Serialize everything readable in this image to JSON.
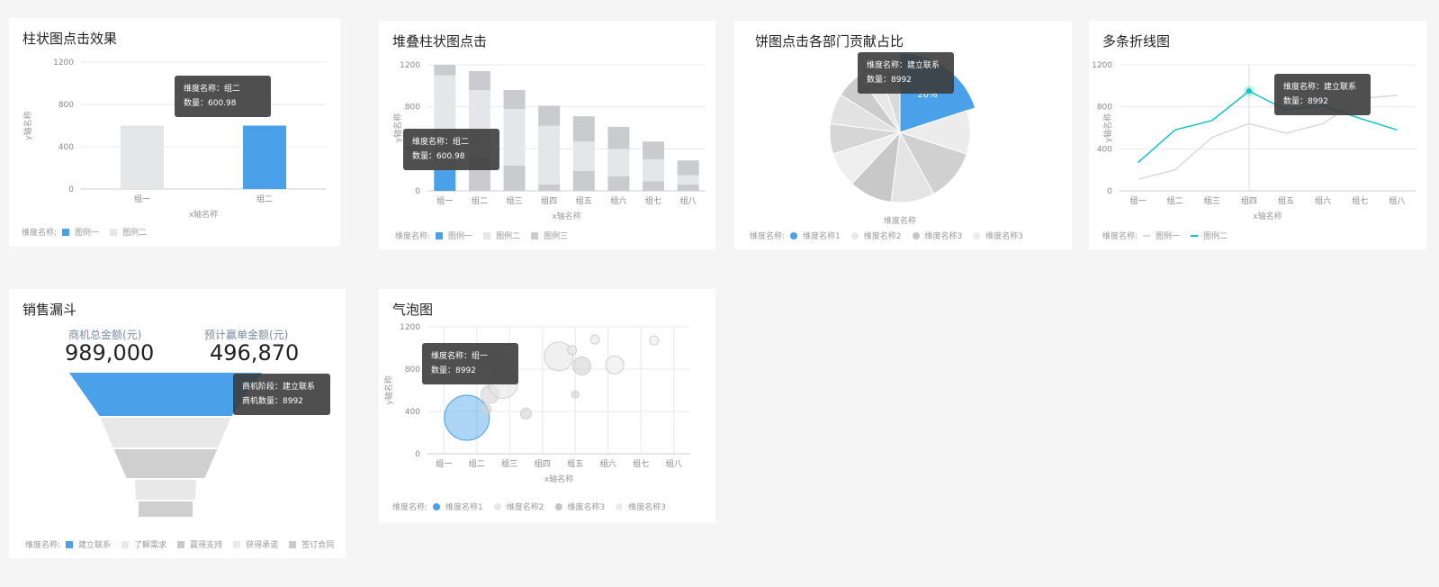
{
  "colors": {
    "blue": "#4aa1ea",
    "cyan": "#13c2c2",
    "light": "#e4e6ea",
    "mid": "#c9cbcf",
    "lightgray": "#e8e8e8",
    "darkgray": "#c4c4c4"
  },
  "card1": {
    "title": "柱状图点击效果",
    "chart_data": {
      "type": "bar",
      "categories": [
        "组一",
        "组二"
      ],
      "values": [
        600,
        600
      ],
      "ylim": [
        0,
        1200
      ],
      "yticks": [
        "0",
        "400",
        "800",
        "1200"
      ],
      "xlabel": "x轴名称",
      "ylabel": "y轴名称",
      "series": [
        {
          "name": "图例一"
        },
        {
          "name": "图例二"
        }
      ]
    },
    "legend_prefix": "维度名称:",
    "legend": [
      "图例一",
      "图例二"
    ],
    "tooltip": {
      "line1": "维度名称：组二",
      "line2": "数量：600.98"
    }
  },
  "card2": {
    "title": "堆叠柱状图点击",
    "chart_data": {
      "type": "bar",
      "stacked": true,
      "categories": [
        "组一",
        "组二",
        "组三",
        "组四",
        "组五",
        "组六",
        "组七",
        "组八"
      ],
      "series": [
        {
          "name": "图例一",
          "values": [
            200,
            330,
            240,
            60,
            190,
            140,
            90,
            60
          ]
        },
        {
          "name": "图例二",
          "values": [
            900,
            630,
            540,
            560,
            280,
            260,
            210,
            90
          ]
        },
        {
          "name": "图例三",
          "values": [
            100,
            180,
            180,
            190,
            240,
            210,
            170,
            140
          ]
        }
      ],
      "ylim": [
        0,
        1200
      ],
      "yticks": [
        "0",
        "400",
        "800",
        "1200"
      ],
      "xlabel": "x轴名称",
      "ylabel": "y轴名称"
    },
    "legend_prefix": "维度名称:",
    "legend": [
      "图例一",
      "图例二",
      "图例三"
    ],
    "tooltip": {
      "line1": "维度名称：组二",
      "line2": "数量：600.98"
    }
  },
  "card3": {
    "title": "饼图点击各部门贡献占比",
    "chart_data": {
      "type": "pie",
      "slices": [
        {
          "name": "维度名称1",
          "value": 20
        },
        {
          "name": "维度名称2",
          "value": 10
        },
        {
          "name": "维度名称3",
          "value": 12
        },
        {
          "name": "维度名称3",
          "value": 10
        },
        {
          "name": "维度名称2",
          "value": 10
        },
        {
          "name": "维度名称3",
          "value": 8
        },
        {
          "name": "维度名称2",
          "value": 7
        },
        {
          "name": "维度名称3",
          "value": 7
        },
        {
          "name": "维度名称2",
          "value": 6
        },
        {
          "name": "维度名称3",
          "value": 5
        },
        {
          "name": "维度名称2",
          "value": 5
        }
      ],
      "highlight_label": "20%",
      "xlabel": "维度名称"
    },
    "legend_prefix": "维度名称:",
    "legend": [
      "维度名称1",
      "维度名称2",
      "维度名称3",
      "维度名称3"
    ],
    "tooltip": {
      "line1": "维度名称：建立联系",
      "line2": "数量：8992"
    }
  },
  "card4": {
    "title": "多条折线图",
    "chart_data": {
      "type": "line",
      "categories": [
        "组一",
        "组二",
        "组三",
        "组四",
        "组五",
        "组六",
        "组七",
        "组八"
      ],
      "series": [
        {
          "name": "图例一",
          "values": [
            110,
            200,
            510,
            640,
            550,
            640,
            880,
            910
          ]
        },
        {
          "name": "图例二",
          "values": [
            270,
            580,
            670,
            950,
            770,
            810,
            690,
            580
          ]
        }
      ],
      "ylim": [
        0,
        1200
      ],
      "yticks": [
        "0",
        "400",
        "800",
        "1200"
      ],
      "xlabel": "x轴名称",
      "ylabel": "y轴名称"
    },
    "legend_prefix": "维度名称:",
    "legend": [
      "图例一",
      "图例二"
    ],
    "tooltip": {
      "line1": "维度名称：建立联系",
      "line2": "数量：8992"
    }
  },
  "card5": {
    "title": "销售漏斗",
    "stat1_label": "商机总金额(元)",
    "stat1_value": "989,000",
    "stat2_label": "预计赢单金额(元)",
    "stat2_value": "496,870",
    "chart_data": {
      "type": "funnel",
      "stages": [
        "建立联系",
        "了解需求",
        "赢得支持",
        "获得承诺",
        "签订合同"
      ]
    },
    "legend_prefix": "维度名称:",
    "legend": [
      "建立联系",
      "了解需求",
      "赢得支持",
      "获得承诺",
      "签订合同"
    ],
    "tooltip": {
      "line1": "商机阶段：建立联系",
      "line2": "商机数量：8992"
    }
  },
  "card6": {
    "title": "气泡图",
    "chart_data": {
      "type": "scatter",
      "categories": [
        "组一",
        "组二",
        "组三",
        "组四",
        "组五",
        "组六",
        "组七",
        "组八"
      ],
      "points": [
        {
          "x": 1.7,
          "y": 340,
          "r": 25,
          "series": 0
        },
        {
          "x": 2.4,
          "y": 560,
          "r": 10,
          "series": 2
        },
        {
          "x": 2.8,
          "y": 660,
          "r": 16,
          "series": 1
        },
        {
          "x": 2.5,
          "y": 850,
          "r": 13,
          "series": 1
        },
        {
          "x": 2.3,
          "y": 420,
          "r": 5,
          "series": 2
        },
        {
          "x": 3.5,
          "y": 380,
          "r": 6,
          "series": 2
        },
        {
          "x": 4.5,
          "y": 920,
          "r": 16,
          "series": 1
        },
        {
          "x": 4.9,
          "y": 980,
          "r": 5,
          "series": 1
        },
        {
          "x": 5.2,
          "y": 830,
          "r": 10,
          "series": 2
        },
        {
          "x": 5.0,
          "y": 560,
          "r": 4,
          "series": 2
        },
        {
          "x": 5.6,
          "y": 1080,
          "r": 5,
          "series": 1
        },
        {
          "x": 6.2,
          "y": 840,
          "r": 10,
          "series": 3
        },
        {
          "x": 7.4,
          "y": 1070,
          "r": 5,
          "series": 3
        }
      ],
      "ylim": [
        0,
        1200
      ],
      "yticks": [
        "0",
        "400",
        "800",
        "1200"
      ],
      "xlabel": "x轴名称",
      "ylabel": "y轴名称"
    },
    "legend_prefix": "维度名称:",
    "legend": [
      "维度名称1",
      "维度名称2",
      "维度名称3",
      "维度名称3"
    ],
    "tooltip": {
      "line1": "维度名称：组一",
      "line2": "数量：8992"
    }
  }
}
